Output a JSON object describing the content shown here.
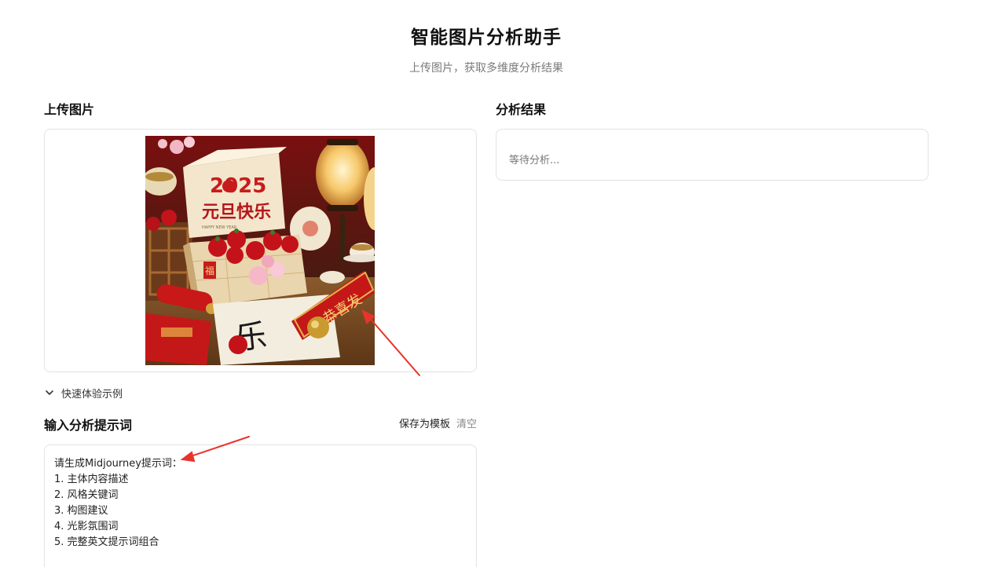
{
  "header": {
    "title": "智能图片分析助手",
    "subtitle": "上传图片，获取多维度分析结果"
  },
  "upload": {
    "title": "上传图片",
    "image_text": {
      "year": "2025",
      "greeting": "元旦快乐",
      "box_small": "HAPPY NEW YEAR",
      "side_tag": "福",
      "scroll_chars": "恭喜发"
    }
  },
  "examples": {
    "toggle_label": "快速体验示例",
    "icon": "chevron-down-icon"
  },
  "prompt": {
    "title": "输入分析提示词",
    "save_template_label": "保存为模板",
    "clear_label": "清空",
    "lines": [
      "请生成Midjourney提示词：",
      "1. 主体内容描述",
      "2. 风格关键词",
      "3. 构图建议",
      "4. 光影氛围词",
      "5. 完整英文提示词组合"
    ]
  },
  "result": {
    "title": "分析结果",
    "placeholder": "等待分析..."
  },
  "colors": {
    "annotation_arrow": "#e8352b",
    "card_border": "#e3e3e3",
    "subtitle": "#7a7a7a"
  }
}
